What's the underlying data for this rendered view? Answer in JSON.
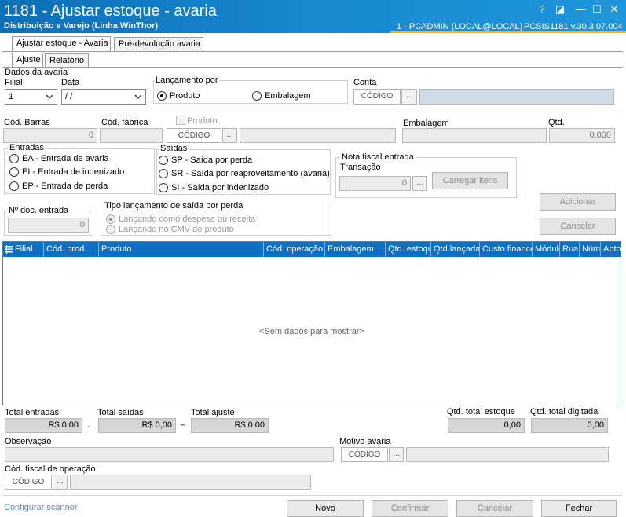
{
  "window": {
    "title": "1181 - Ajustar estoque - avaria",
    "subtitle": "Distribuição e Varejo (Linha WinThor)",
    "user": "1 - PCADMIN (LOCAL@LOCAL)",
    "system": "PCSIS1181  v.30.3.07.004",
    "buttons": {
      "help": "?",
      "restore": "◪",
      "minimize": "—",
      "maximize": "☐",
      "close": "✕"
    }
  },
  "tabs": {
    "main": [
      "Ajustar estoque - Avaria",
      "Pré-devolução avaria"
    ],
    "sub": [
      "Ajuste",
      "Relatório"
    ]
  },
  "dados": {
    "section": "Dados da avaria",
    "filial_label": "Filial",
    "filial_value": "1",
    "data_label": "Data",
    "data_value": " / /",
    "lancamento_label": "Lançamento por",
    "lancamento_options": [
      "Produto",
      "Embalagem"
    ],
    "conta_label": "Conta",
    "codigo": "CÓDIGO",
    "dots": "..."
  },
  "produto": {
    "cod_barras_label": "Cód. Barras",
    "cod_barras_value": "0",
    "cod_fabrica_label": "Cód. fábrica",
    "produto_label": "Produto",
    "codigo": "CÓDIGO",
    "dots": "...",
    "embalagem_label": "Embalagem",
    "qtd_label": "Qtd.",
    "qtd_value": "0,000"
  },
  "entradas": {
    "title": "Entradas",
    "options": [
      "EA - Entrada de avaria",
      "EI - Entrada de indenizado",
      "EP - Entrada de perda"
    ]
  },
  "saidas": {
    "title": "Saídas",
    "options": [
      "SP - Saída por perda",
      "SR - Saída por reaproveitamento (avaria)",
      "SI - Saída por indenizado"
    ]
  },
  "nota": {
    "title": "Nota fiscal entrada",
    "transacao_label": "Transação",
    "transacao_value": "0",
    "dots": "...",
    "carregar": "Carregar itens"
  },
  "actions": {
    "adicionar": "Adicionar",
    "cancelar": "Cancelar"
  },
  "docentrada": {
    "label": "Nº doc. entrada",
    "value": "0"
  },
  "tiposaida": {
    "title": "Tipo lançamento de saída por perda",
    "options": [
      "Lançando como despesa ou receita",
      "Lançando no CMV do produto"
    ]
  },
  "grid": {
    "columns": [
      "Filial",
      "Cód. prod.",
      "Produto",
      "Cód. operação",
      "Embalagem",
      "Qtd. estoque",
      "Qtd.lançada",
      "Custo financeiro",
      "Módulo",
      "Rua",
      "Núm",
      "Apto"
    ],
    "empty": "<Sem dados para mostrar>"
  },
  "totals": {
    "entradas_label": "Total entradas",
    "entradas_value": "R$ 0,00",
    "minus": "-",
    "saidas_label": "Total saídas",
    "saidas_value": "R$ 0,00",
    "equals": "=",
    "ajuste_label": "Total ajuste",
    "ajuste_value": "R$ 0,00",
    "qtd_estoque_label": "Qtd. total estoque",
    "qtd_estoque_value": "0,00",
    "qtd_digitada_label": "Qtd. total digitada",
    "qtd_digitada_value": "0,00"
  },
  "bottom": {
    "observacao_label": "Observação",
    "motivo_label": "Motivo avaria",
    "cfop_label": "Cód. fiscal de operação",
    "codigo": "CÓDIGO",
    "dots": "..."
  },
  "footer": {
    "configurar": "Configurar scanner",
    "novo": "Novo",
    "confirmar": "Confirmar",
    "cancelar": "Cancelar",
    "fechar": "Fechar"
  }
}
